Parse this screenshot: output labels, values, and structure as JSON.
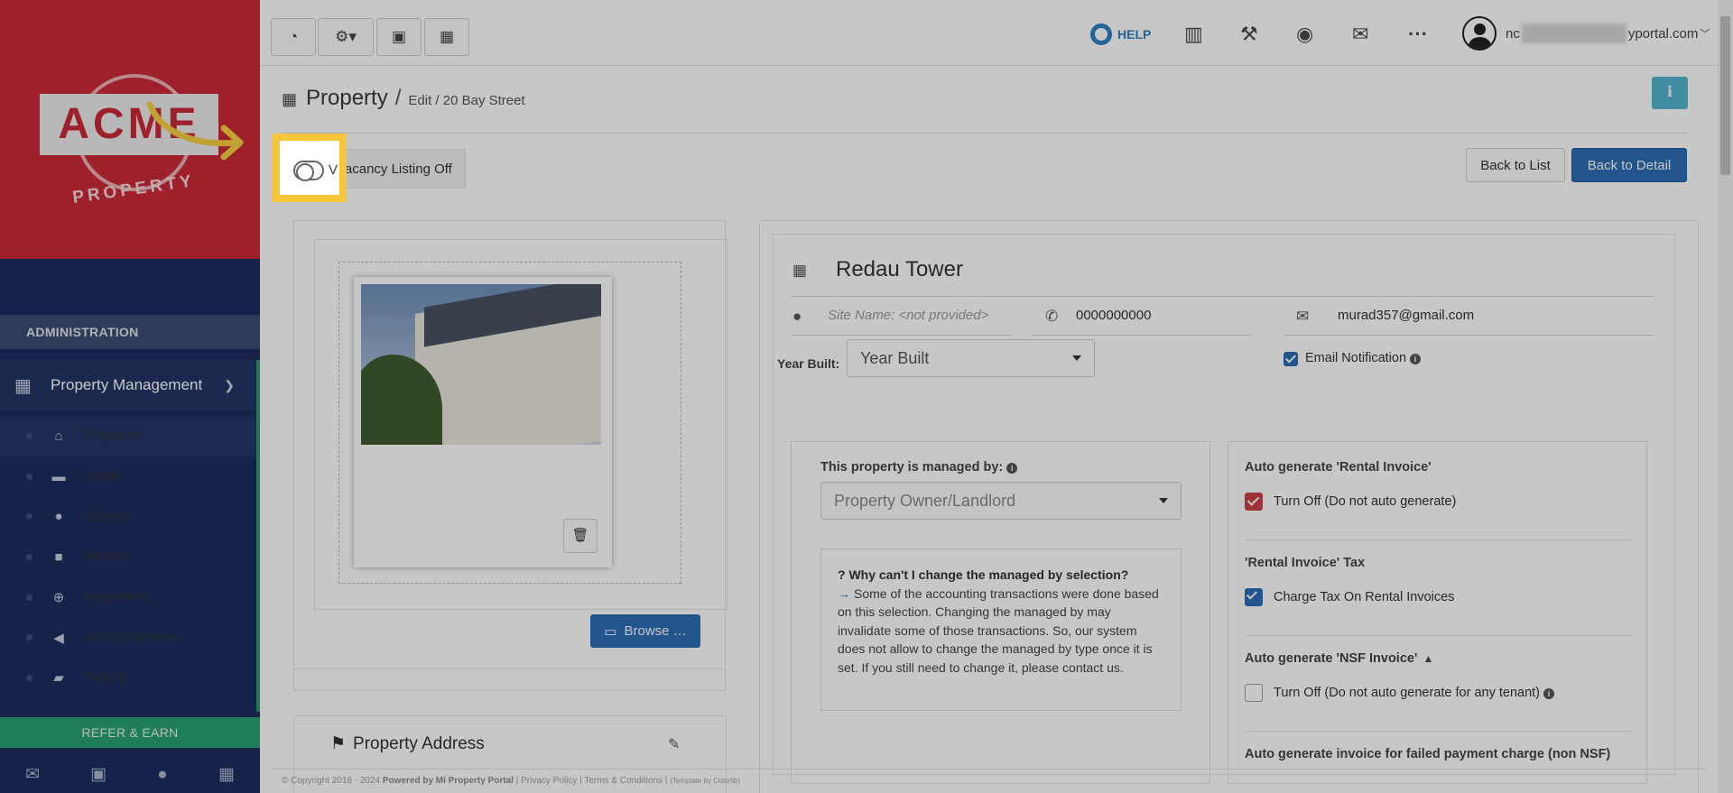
{
  "brand": {
    "logo_text": "ACME",
    "logo_sub": "PROPERTY"
  },
  "sidebar": {
    "section": "ADMINISTRATION",
    "group": {
      "label": "Property Management",
      "icon": "building-icon"
    },
    "items": [
      {
        "label": "Properties",
        "icon": "home-icon",
        "active": true
      },
      {
        "label": "Assets",
        "icon": "archive-icon"
      },
      {
        "label": "Owners",
        "icon": "user-icon"
      },
      {
        "label": "Vendors",
        "icon": "briefcase-icon"
      },
      {
        "label": "Inspections",
        "icon": "search-plus-icon"
      },
      {
        "label": "Announcements",
        "icon": "bullhorn-icon"
      },
      {
        "label": "Parking",
        "icon": "car-icon"
      }
    ],
    "refer": "REFER & EARN",
    "bottom_icons": [
      "envelope-icon",
      "briefcase-icon",
      "user-icon",
      "calculator-icon"
    ]
  },
  "topbar": {
    "help": "HELP",
    "user_prefix": "nc",
    "user_suffix": "yportal.com"
  },
  "page": {
    "title": "Property",
    "breadcrumb": "Edit / 20 Bay Street",
    "vacancy_toggle": "Vacancy Listing Off",
    "vacancy_toggle_visible": "V",
    "vacancy_toggle_tail": "cancy Listing Off",
    "back_to_list": "Back to List",
    "back_to_detail": "Back to Detail",
    "browse": "Browse …",
    "address_title": "Property Address"
  },
  "property": {
    "name": "Redau Tower",
    "site_name_placeholder": "Site Name: <not provided>",
    "phone": "0000000000",
    "email": "murad357@gmail.com",
    "email_notification": "Email Notification",
    "year_built_label": "Year Built:",
    "year_built_value": "Year Built",
    "managed_by_label": "This property is managed by:",
    "managed_by_value": "Property Owner/Landlord",
    "notice_question": "Why can't I change the managed by selection?",
    "notice_body": "Some of the accounting transactions were done based on this selection. Changing the managed by may invalidate some of those transactions. So, our system does not allow to change the managed by type once it is set. If you still need to change it, please contact us."
  },
  "invoice": {
    "rental_title": "Auto generate 'Rental Invoice'",
    "rental_opt": "Turn Off (Do not auto generate)",
    "tax_title": "'Rental Invoice' Tax",
    "tax_opt": "Charge Tax On Rental Invoices",
    "nsf_title": "Auto generate 'NSF Invoice'",
    "nsf_opt": "Turn Off (Do not auto generate for any tenant)",
    "failed_title": "Auto generate invoice for failed payment charge (non NSF)"
  },
  "footer": {
    "copyright": "© Copyright 2016 - 2024",
    "powered": "Powered by Mi Property Portal",
    "privacy": "Privacy Policy",
    "terms": "Terms & Conditions",
    "template": "(Template by Colorlib)"
  }
}
